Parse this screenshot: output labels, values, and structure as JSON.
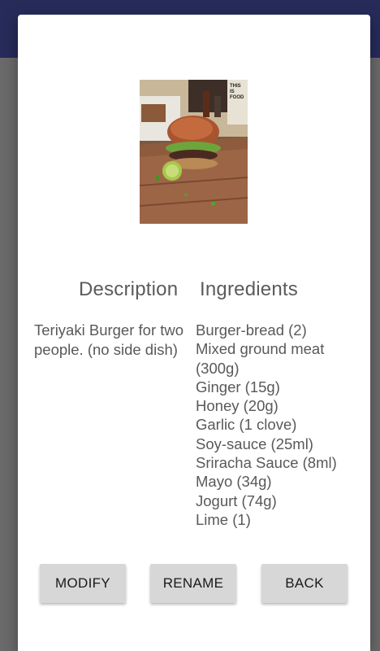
{
  "recipe": {
    "image_alt": "burger-photo",
    "headings": {
      "description": "Description",
      "ingredients": "Ingredients"
    },
    "description": "Teriyaki Burger for two people. (no side dish)",
    "ingredients": [
      "Burger-bread (2)",
      "Mixed ground meat (300g)",
      "Ginger (15g)",
      "Honey (20g)",
      "Garlic (1 clove)",
      "Soy-sauce (25ml)",
      "Sriracha Sauce (8ml)",
      "Mayo (34g)",
      "Jogurt (74g)",
      "Lime (1)"
    ]
  },
  "buttons": {
    "modify": "MODIFY",
    "rename": "RENAME",
    "back": "BACK"
  },
  "colors": {
    "appbar": "#262b5a",
    "button_bg": "#d7d7d7",
    "text": "#595959"
  }
}
